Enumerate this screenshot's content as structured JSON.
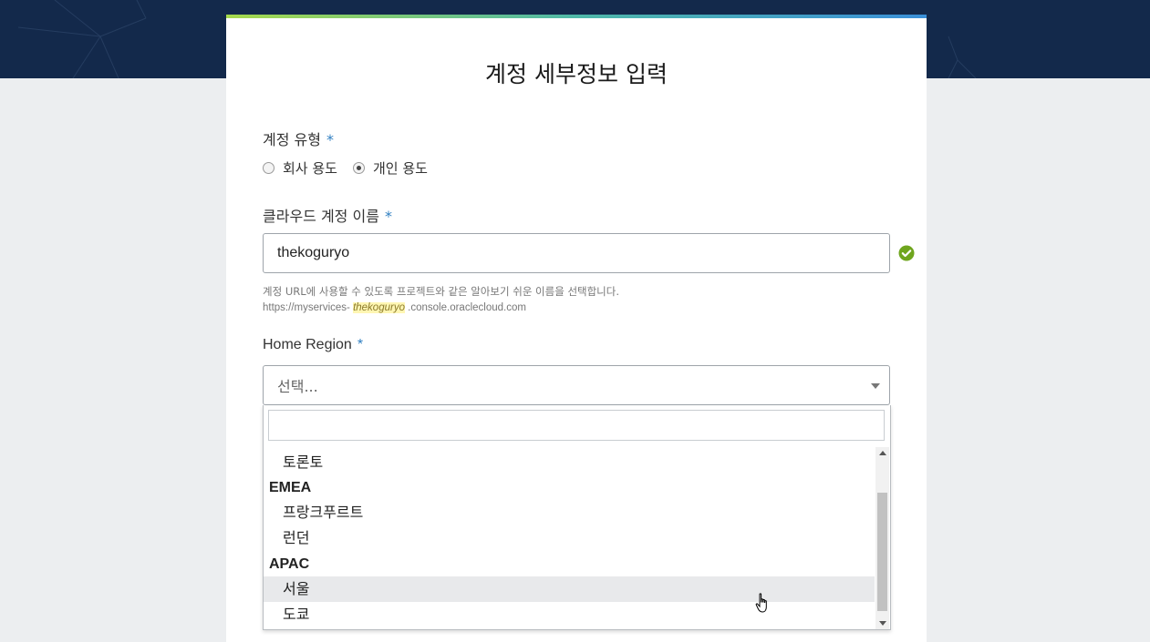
{
  "page_title": "계정 세부정보 입력",
  "account_type": {
    "label": "계정 유형",
    "required_mark": "*",
    "options": [
      {
        "label": "회사 용도",
        "selected": false
      },
      {
        "label": "개인 용도",
        "selected": true
      }
    ]
  },
  "cloud_account_name": {
    "label": "클라우드 계정 이름",
    "required_mark": "*",
    "value": "thekoguryo",
    "hint": "계정 URL에 사용할 수 있도록 프로젝트와 같은 알아보기 쉬운 이름을 선택합니다.",
    "url_prefix": "https://myservices- ",
    "url_highlight": "thekoguryo",
    "url_suffix": " .console.oraclecloud.com",
    "status_icon": "check-circle-icon",
    "status_color": "#6fa51e"
  },
  "home_region": {
    "label": "Home Region",
    "required_mark": "*",
    "placeholder": "선택...",
    "search_value": "",
    "list": {
      "item_toronto": "토론토",
      "group_emea": "EMEA",
      "item_frankfurt": "프랑크푸르트",
      "item_london": "런던",
      "group_apac": "APAC",
      "item_seoul": "서울",
      "item_tokyo": "도쿄"
    },
    "hovered_item": "서울"
  },
  "colors": {
    "header_background": "#13294b",
    "required_mark": "#2f7fc1",
    "accent_gradient": [
      "#a6d94c",
      "#4fb8a8",
      "#3a8fd8"
    ]
  }
}
